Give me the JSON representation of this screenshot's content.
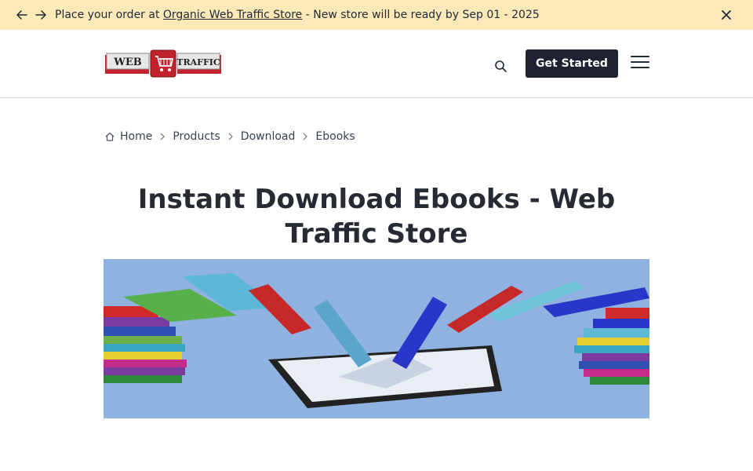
{
  "announcement": {
    "prefix": "Place your order at ",
    "link_text": "Organic Web Traffic Store",
    "suffix": " - New store will be ready by Sep 01 - 2025"
  },
  "header": {
    "logo_left": "WEB",
    "logo_right": "TRAFFIC",
    "cta_label": "Get Started"
  },
  "breadcrumb": {
    "items": [
      "Home",
      "Products",
      "Download",
      "Ebooks"
    ]
  },
  "page": {
    "title": "Instant Download Ebooks - Web Traffic Store"
  },
  "colors": {
    "announcement_bg": "#fde9b8",
    "cta_bg": "#1f2230",
    "hero_bg": "#8fb2e0"
  }
}
